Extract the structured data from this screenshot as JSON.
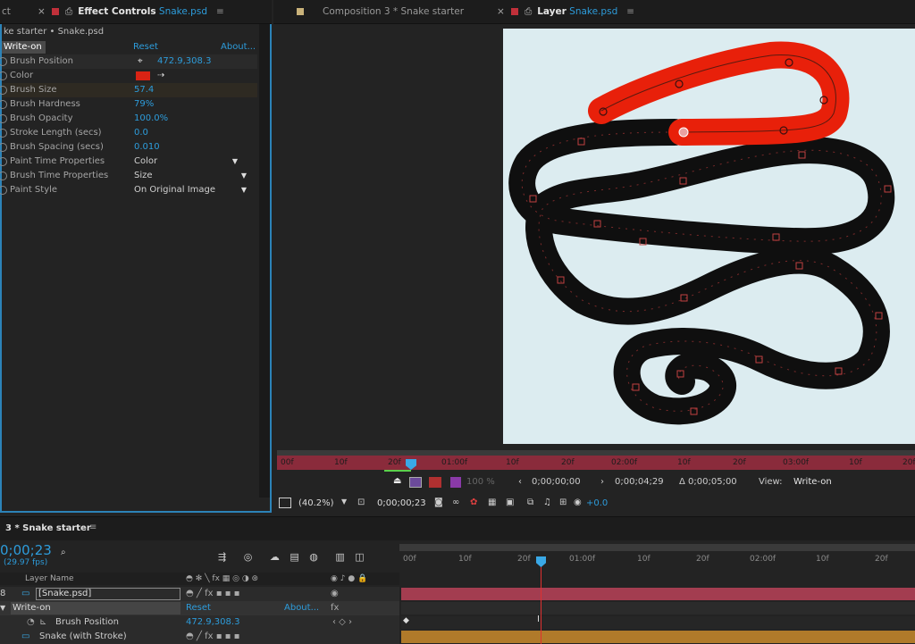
{
  "tabs": {
    "effect_controls": {
      "prefix": "ct",
      "label": "Effect Controls",
      "file": "Snake.psd"
    },
    "composition": {
      "label": "Composition 3 * Snake starter"
    },
    "layer": {
      "label": "Layer",
      "file": "Snake.psd"
    }
  },
  "effect_controls": {
    "breadcrumb": "ke starter • Snake.psd",
    "effect_name": "Write-on",
    "reset": "Reset",
    "about": "About...",
    "properties": [
      {
        "label": "Brush Position",
        "value": "472.9,308.3"
      },
      {
        "label": "Color",
        "value": ""
      },
      {
        "label": "Brush Size",
        "value": "57.4"
      },
      {
        "label": "Brush Hardness",
        "value": "79%"
      },
      {
        "label": "Brush Opacity",
        "value": "100.0%"
      },
      {
        "label": "Stroke Length (secs)",
        "value": "0.0"
      },
      {
        "label": "Brush Spacing (secs)",
        "value": "0.010"
      },
      {
        "label": "Paint Time Properties",
        "value": "Color"
      },
      {
        "label": "Brush Time Properties",
        "value": "Size"
      },
      {
        "label": "Paint Style",
        "value": "On Original Image"
      }
    ],
    "color_swatch": "#d92314"
  },
  "viewer_ruler": {
    "ticks": [
      "00f",
      "10f",
      "20f",
      "01:00f",
      "10f",
      "20f",
      "02:00f",
      "10f",
      "20f",
      "03:00f",
      "10f",
      "20f"
    ]
  },
  "viewer_controls": {
    "opacity": "100 %",
    "current": "0;00;00;00",
    "end": "0;00;04;29",
    "duration": "Δ 0;00;05;00",
    "view_label": "View:",
    "view_value": "Write-on"
  },
  "viewer_footer": {
    "zoom": "(40.2%)",
    "timecode": "0;00;00;23",
    "exposure": "+0.0"
  },
  "timeline": {
    "tab_label": "3 * Snake starter",
    "timecode": "0;00;23",
    "fps": "(29.97 fps)",
    "search_placeholder": "",
    "column_layer_name": "Layer Name",
    "ticks": [
      "00f",
      "10f",
      "20f",
      "01:00f",
      "10f",
      "20f",
      "02:00f",
      "10f",
      "20f"
    ],
    "rows": [
      {
        "label": "[Snake.psd]",
        "value": ""
      },
      {
        "label": "Write-on",
        "reset": "Reset",
        "about": "About..."
      },
      {
        "label": "Brush Position",
        "value": "472.9,308.3"
      },
      {
        "label": "Snake (with Stroke)",
        "value": ""
      }
    ]
  },
  "colors": {
    "accent": "#2d9cdb",
    "stroke_red": "#e8200a",
    "ruler": "#8a2b3b",
    "track_gold": "#b07a2a"
  }
}
